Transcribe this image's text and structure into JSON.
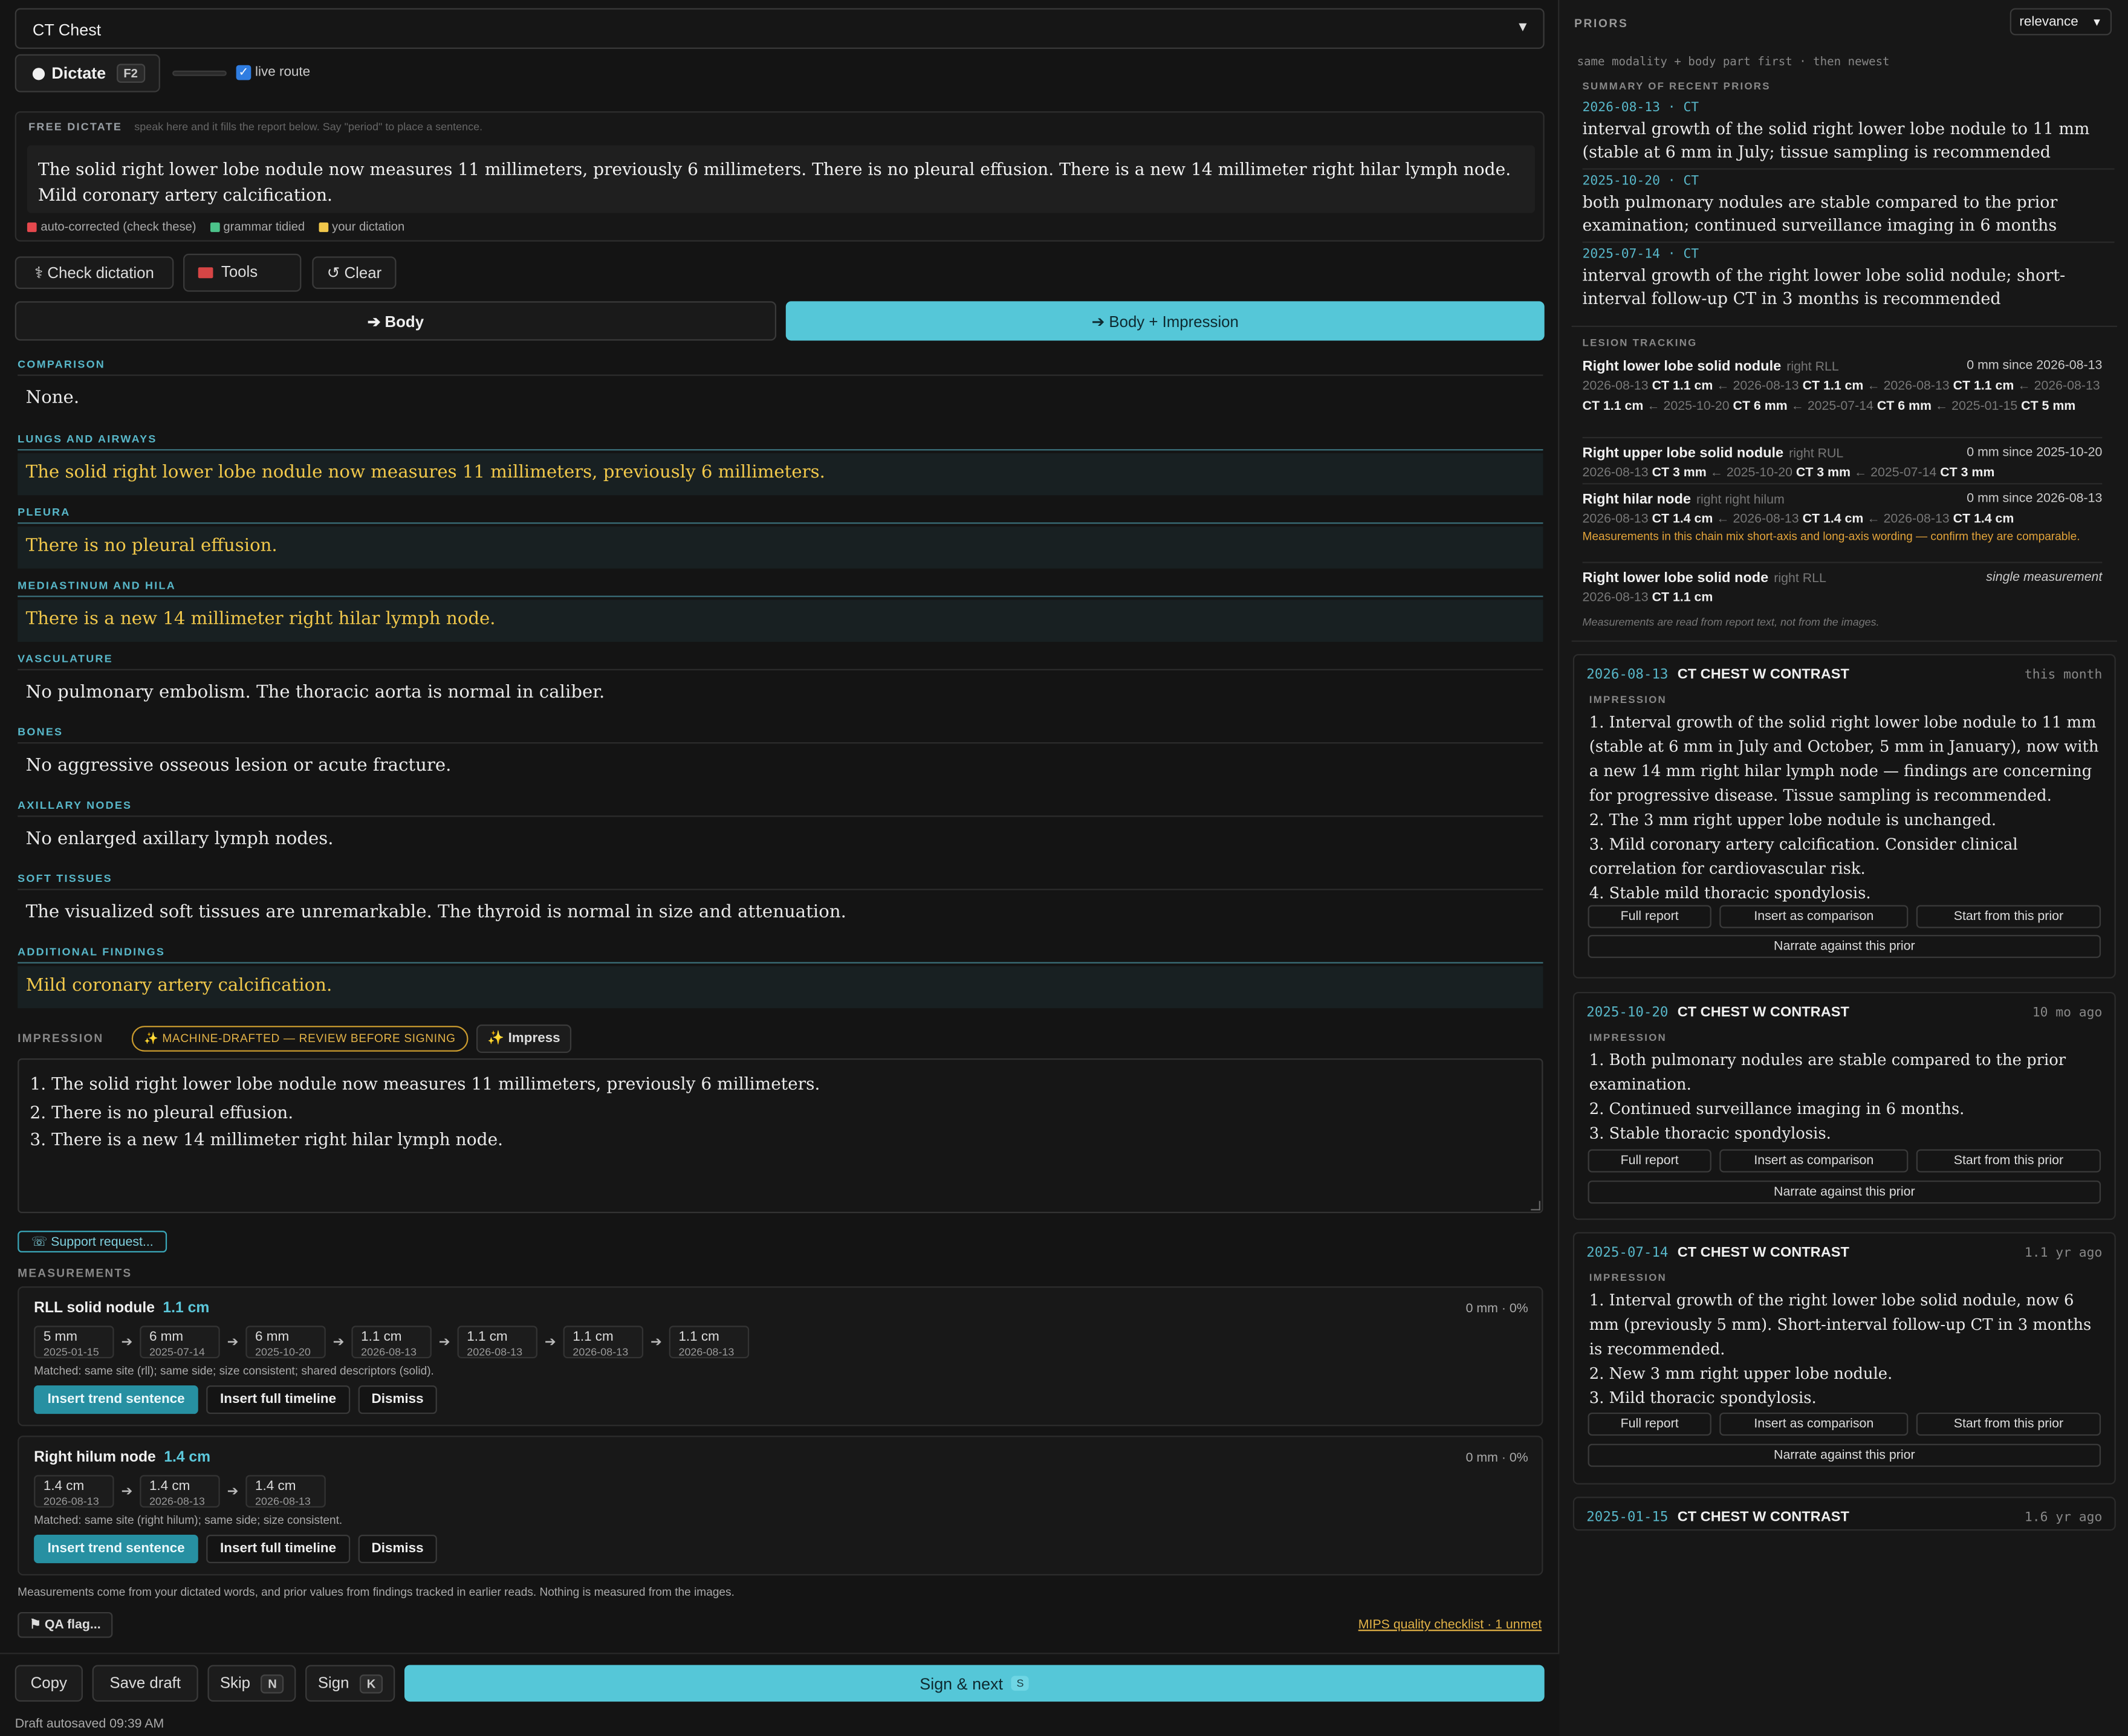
{
  "exam": {
    "selected": "CT Chest"
  },
  "dictate": {
    "label": "Dictate",
    "key": "F2",
    "live_route_label": "live route",
    "live_route_checked": true
  },
  "free_dictate": {
    "title": "FREE DICTATE",
    "hint": "speak here and it fills the report below. Say \"period\" to place a sentence.",
    "text": "The solid right lower lobe nodule now measures 11 millimeters, previously 6 millimeters. There is no pleural effusion. There is a new 14 millimeter right hilar lymph node. Mild coronary artery calcification.",
    "legend": [
      {
        "label": "auto-corrected (check these)",
        "color": "#e5484d"
      },
      {
        "label": "grammar tidied",
        "color": "#4cc38a"
      },
      {
        "label": "your dictation",
        "color": "#f1c84b"
      }
    ]
  },
  "tools": {
    "check": "⚕ Check dictation",
    "tools": "Tools",
    "clear": "↺ Clear"
  },
  "route": {
    "body": "➔ Body",
    "body_impression": "➔ Body + Impression"
  },
  "sections": [
    {
      "label": "COMPARISON",
      "text": "None.",
      "highlight": false
    },
    {
      "label": "LUNGS AND AIRWAYS",
      "text": "The solid right lower lobe nodule now measures 11 millimeters, previously 6 millimeters.",
      "highlight": true
    },
    {
      "label": "PLEURA",
      "text": "There is no pleural effusion.",
      "highlight": true
    },
    {
      "label": "MEDIASTINUM AND HILA",
      "text": "There is a new 14 millimeter right hilar lymph node.",
      "highlight": true
    },
    {
      "label": "VASCULATURE",
      "text": "No pulmonary embolism. The thoracic aorta is normal in caliber.",
      "highlight": false
    },
    {
      "label": "BONES",
      "text": "No aggressive osseous lesion or acute fracture.",
      "highlight": false
    },
    {
      "label": "AXILLARY NODES",
      "text": "No enlarged axillary lymph nodes.",
      "highlight": false
    },
    {
      "label": "SOFT TISSUES",
      "text": "The visualized soft tissues are unremarkable. The thyroid is normal in size and attenuation.",
      "highlight": false
    },
    {
      "label": "ADDITIONAL FINDINGS",
      "text": "Mild coronary artery calcification.",
      "highlight": true
    }
  ],
  "impression": {
    "label": "IMPRESSION",
    "badge": "✨ MACHINE-DRAFTED — REVIEW BEFORE SIGNING",
    "impress_btn": "✨ Impress",
    "lines": [
      "1. The solid right lower lobe nodule now measures 11 millimeters, previously 6 millimeters.",
      "2. There is no pleural effusion.",
      "3. There is a new 14 millimeter right hilar lymph node."
    ]
  },
  "support": "☏ Support request...",
  "measurements": {
    "label": "MEASUREMENTS",
    "items": [
      {
        "name": "RLL solid nodule",
        "value": "1.1 cm",
        "stat": "0 mm · 0%",
        "chips": [
          {
            "v": "5 mm",
            "d": "2025-01-15"
          },
          {
            "v": "6 mm",
            "d": "2025-07-14"
          },
          {
            "v": "6 mm",
            "d": "2025-10-20"
          },
          {
            "v": "1.1 cm",
            "d": "2026-08-13"
          },
          {
            "v": "1.1 cm",
            "d": "2026-08-13"
          },
          {
            "v": "1.1 cm",
            "d": "2026-08-13"
          },
          {
            "v": "1.1 cm",
            "d": "2026-08-13"
          }
        ],
        "matched": "Matched: same site (rll); same side; size consistent; shared descriptors (solid)."
      },
      {
        "name": "Right hilum node",
        "value": "1.4 cm",
        "stat": "0 mm · 0%",
        "chips": [
          {
            "v": "1.4 cm",
            "d": "2026-08-13"
          },
          {
            "v": "1.4 cm",
            "d": "2026-08-13"
          },
          {
            "v": "1.4 cm",
            "d": "2026-08-13"
          }
        ],
        "matched": "Matched: same site (right hilum); same side; size consistent."
      }
    ],
    "buttons": {
      "trend": "Insert trend sentence",
      "timeline": "Insert full timeline",
      "dismiss": "Dismiss"
    },
    "footnote": "Measurements come from your dictated words, and prior values from findings tracked in earlier reads. Nothing is measured from the images."
  },
  "qa": "⚑ QA flag...",
  "mips": "MIPS quality checklist · 1 unmet",
  "bottom": {
    "copy": "Copy",
    "save": "Save draft",
    "skip": "Skip",
    "skip_key": "N",
    "sign": "Sign",
    "sign_key": "K",
    "sign_next": "Sign & next",
    "sign_next_key": "S",
    "autosave": "Draft autosaved 09:39 AM"
  },
  "priors": {
    "title": "PRIORS",
    "sort": "relevance",
    "subtitle": "same modality + body part first · then newest",
    "summary_label": "SUMMARY OF RECENT PRIORS",
    "summary": [
      {
        "date": "2026-08-13 · CT",
        "text": "interval growth of the solid right lower lobe nodule to 11 mm (stable at 6 mm in July; tissue sampling is recommended"
      },
      {
        "date": "2025-10-20 · CT",
        "text": "both pulmonary nodules are stable compared to the prior examination; continued surveillance imaging in 6 months"
      },
      {
        "date": "2025-07-14 · CT",
        "text": "interval growth of the right lower lobe solid nodule; short-interval follow-up CT in 3 months is recommended"
      }
    ],
    "lesion_label": "LESION TRACKING",
    "lesions": [
      {
        "name": "Right lower lobe solid nodule",
        "loc": "right RLL",
        "since": "0 mm since 2026-08-13",
        "chain": [
          [
            "2026-08-13",
            "CT 1.1 cm"
          ],
          [
            "2026-08-13",
            "CT 1.1 cm"
          ],
          [
            "2026-08-13",
            "CT 1.1 cm"
          ],
          [
            "2026-08-13",
            "CT 1.1 cm"
          ],
          [
            "2025-10-20",
            "CT 6 mm"
          ],
          [
            "2025-07-14",
            "CT 6 mm"
          ],
          [
            "2025-01-15",
            "CT 5 mm"
          ]
        ],
        "warn": ""
      },
      {
        "name": "Right upper lobe solid nodule",
        "loc": "right RUL",
        "since": "0 mm since 2025-10-20",
        "chain": [
          [
            "2026-08-13",
            "CT 3 mm"
          ],
          [
            "2025-10-20",
            "CT 3 mm"
          ],
          [
            "2025-07-14",
            "CT 3 mm"
          ]
        ],
        "warn": ""
      },
      {
        "name": "Right hilar node",
        "loc": "right right hilum",
        "since": "0 mm since 2026-08-13",
        "chain": [
          [
            "2026-08-13",
            "CT 1.4 cm"
          ],
          [
            "2026-08-13",
            "CT 1.4 cm"
          ],
          [
            "2026-08-13",
            "CT 1.4 cm"
          ]
        ],
        "warn": "Measurements in this chain mix short-axis and long-axis wording — confirm they are comparable."
      },
      {
        "name": "Right lower lobe solid node",
        "loc": "right RLL",
        "since": "single measurement",
        "chain": [
          [
            "2026-08-13",
            "CT 1.1 cm"
          ]
        ],
        "warn": ""
      }
    ],
    "lesion_note": "Measurements are read from report text, not from the images.",
    "cards": [
      {
        "date": "2026-08-13",
        "title": "CT CHEST W CONTRAST",
        "ago": "this month",
        "imp_label": "IMPRESSION",
        "lines": [
          "1. Interval growth of the solid right lower lobe nodule to 11 mm (stable at 6 mm in July and October, 5 mm in January), now with a new 14 mm right hilar lymph node — findings are concerning for progressive disease. Tissue sampling is recommended.",
          "2. The 3 mm right upper lobe nodule is unchanged.",
          "3. Mild coronary artery calcification. Consider clinical correlation for cardiovascular risk.",
          "4. Stable mild thoracic spondylosis."
        ]
      },
      {
        "date": "2025-10-20",
        "title": "CT CHEST W CONTRAST",
        "ago": "10 mo ago",
        "imp_label": "IMPRESSION",
        "lines": [
          "1. Both pulmonary nodules are stable compared to the prior examination.",
          "2. Continued surveillance imaging in 6 months.",
          "3. Stable thoracic spondylosis."
        ]
      },
      {
        "date": "2025-07-14",
        "title": "CT CHEST W CONTRAST",
        "ago": "1.1 yr ago",
        "imp_label": "IMPRESSION",
        "lines": [
          "1. Interval growth of the right lower lobe solid nodule, now 6 mm (previously 5 mm). Short-interval follow-up CT in 3 months is recommended.",
          "2. New 3 mm right upper lobe nodule.",
          "3. Mild thoracic spondylosis."
        ]
      },
      {
        "date": "2025-01-15",
        "title": "CT CHEST W CONTRAST",
        "ago": "1.6 yr ago",
        "imp_label": "",
        "lines": []
      }
    ],
    "card_buttons": {
      "full": "Full report",
      "insert": "Insert as comparison",
      "start": "Start from this prior",
      "narrate": "Narrate against this prior"
    }
  }
}
